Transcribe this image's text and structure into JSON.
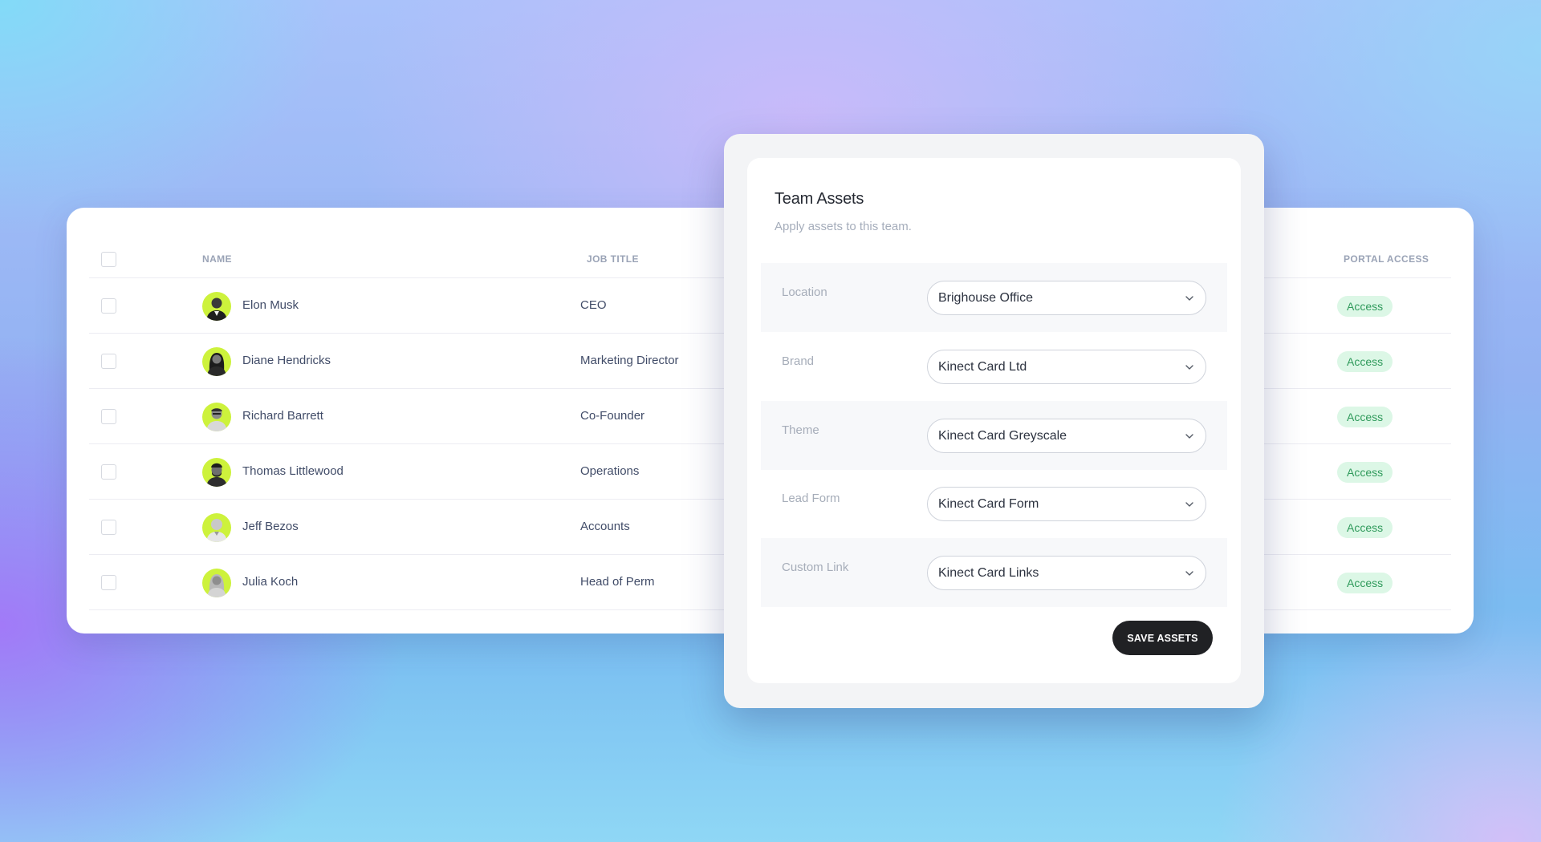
{
  "table": {
    "columns": {
      "name": "NAME",
      "job_title": "JOB TITLE",
      "portal_access": "PORTAL ACCESS"
    },
    "rows": [
      {
        "name": "Elon Musk",
        "job_title": "CEO",
        "portal_access": "Access"
      },
      {
        "name": "Diane Hendricks",
        "job_title": "Marketing Director",
        "portal_access": "Access"
      },
      {
        "name": "Richard Barrett",
        "job_title": "Co-Founder",
        "portal_access": "Access"
      },
      {
        "name": "Thomas Littlewood",
        "job_title": "Operations",
        "portal_access": "Access"
      },
      {
        "name": "Jeff Bezos",
        "job_title": "Accounts",
        "portal_access": "Access"
      },
      {
        "name": "Julia Koch",
        "job_title": "Head of Perm",
        "portal_access": "Access"
      }
    ]
  },
  "modal": {
    "title": "Team Assets",
    "subtitle": "Apply assets to this team.",
    "fields": [
      {
        "label": "Location",
        "value": "Brighouse Office"
      },
      {
        "label": "Brand",
        "value": "Kinect Card Ltd"
      },
      {
        "label": "Theme",
        "value": "Kinect Card Greyscale"
      },
      {
        "label": "Lead Form",
        "value": "Kinect Card Form"
      },
      {
        "label": "Custom Link",
        "value": "Kinect Card Links"
      }
    ],
    "save_label": "SAVE ASSETS"
  },
  "colors": {
    "avatar_accent": "#cdf23c",
    "access_badge_bg": "#dcf7e6",
    "access_badge_text": "#2f9a5b",
    "save_button": "#202124"
  },
  "icons": {
    "select_chevron": "chevron-down-icon",
    "avatar": "user-photo"
  }
}
